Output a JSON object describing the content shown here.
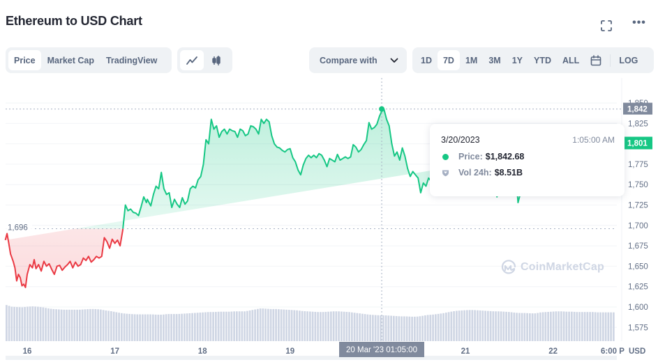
{
  "header": {
    "title": "Ethereum to USD Chart",
    "fullscreen_icon": "fullscreen-icon",
    "more_icon": "more-horizontal-icon",
    "more_label": "•••"
  },
  "toolbar": {
    "view_tabs": [
      {
        "label": "Price",
        "active": true
      },
      {
        "label": "Market Cap",
        "active": false
      },
      {
        "label": "TradingView",
        "active": false
      }
    ],
    "chart_types": [
      {
        "icon": "line-chart-icon",
        "active": true
      },
      {
        "icon": "candlestick-icon",
        "active": false
      }
    ],
    "compare_label": "Compare with",
    "ranges": [
      {
        "label": "1D",
        "active": false
      },
      {
        "label": "7D",
        "active": true
      },
      {
        "label": "1M",
        "active": false
      },
      {
        "label": "3M",
        "active": false
      },
      {
        "label": "1Y",
        "active": false
      },
      {
        "label": "YTD",
        "active": false
      },
      {
        "label": "ALL",
        "active": false
      }
    ],
    "calendar_icon": "calendar-icon",
    "log_label": "LOG"
  },
  "tooltip": {
    "date": "3/20/2023",
    "time": "1:05:00 AM",
    "price_label": "Price:",
    "price_value": "$1,842.68",
    "vol_label": "Vol 24h:",
    "vol_value": "$8.51B"
  },
  "watermark": "CoinMarketCap",
  "colors": {
    "up": "#16c784",
    "down": "#ea3943",
    "volume": "#cfd6e4",
    "crosshair_badge": "#808a9d",
    "current_badge": "#16c784"
  },
  "chart_data": {
    "type": "area",
    "title": "Ethereum to USD Chart",
    "xlabel": "",
    "ylabel": "USD",
    "currency_label": "USD",
    "x_unit": "days since Mar 15 2023 00:00 (local)",
    "x_range": [
      15.75,
      22.72
    ],
    "ylim": [
      1565,
      1868
    ],
    "y_ticks": [
      1575,
      1600,
      1625,
      1650,
      1675,
      1700,
      1725,
      1750,
      1775,
      1800,
      1825,
      1850
    ],
    "y_tick_labels": [
      "1,575",
      "1,600",
      "1,625",
      "1,650",
      "1,675",
      "1,700",
      "1,725",
      "1,750",
      "1,775",
      "1,800",
      "1,825",
      "1,850"
    ],
    "x_ticks": [
      16,
      17,
      18,
      19,
      20,
      21,
      22
    ],
    "x_tick_labels": [
      "16",
      "17",
      "18",
      "19",
      "",
      "21",
      "22"
    ],
    "x_end_label": "6:00 P",
    "baseline": {
      "value": 1696,
      "label": "1,696"
    },
    "crosshair": {
      "x": 20.045,
      "value": 1842.68,
      "x_label": "20 Mar '23   01:05:00",
      "y_label": "1,842"
    },
    "current_price": {
      "value": 1801,
      "label": "1,801"
    },
    "grid": true,
    "series": [
      {
        "name": "Price",
        "x": [
          15.75,
          15.77,
          15.79,
          15.81,
          15.84,
          15.86,
          15.88,
          15.9,
          15.92,
          15.94,
          15.96,
          15.98,
          16.0,
          16.03,
          16.06,
          16.08,
          16.1,
          16.13,
          16.16,
          16.19,
          16.22,
          16.25,
          16.28,
          16.31,
          16.34,
          16.37,
          16.4,
          16.43,
          16.46,
          16.49,
          16.52,
          16.55,
          16.58,
          16.61,
          16.64,
          16.67,
          16.7,
          16.73,
          16.76,
          16.79,
          16.82,
          16.85,
          16.88,
          16.91,
          16.94,
          16.97,
          17.0,
          17.03,
          17.06,
          17.09,
          17.12,
          17.15,
          17.18,
          17.21,
          17.24,
          17.27,
          17.3,
          17.33,
          17.36,
          17.37,
          17.39,
          17.41,
          17.44,
          17.47,
          17.5,
          17.53,
          17.56,
          17.59,
          17.62,
          17.65,
          17.68,
          17.71,
          17.74,
          17.77,
          17.8,
          17.83,
          17.86,
          17.89,
          17.92,
          17.95,
          17.98,
          18.01,
          18.04,
          18.07,
          18.1,
          18.13,
          18.16,
          18.19,
          18.22,
          18.25,
          18.28,
          18.31,
          18.34,
          18.37,
          18.4,
          18.43,
          18.46,
          18.49,
          18.52,
          18.55,
          18.58,
          18.61,
          18.64,
          18.67,
          18.7,
          18.73,
          18.76,
          18.79,
          18.82,
          18.85,
          18.88,
          18.91,
          18.94,
          18.97,
          19.0,
          19.03,
          19.06,
          19.09,
          19.12,
          19.15,
          19.18,
          19.21,
          19.24,
          19.27,
          19.3,
          19.33,
          19.36,
          19.39,
          19.42,
          19.45,
          19.48,
          19.51,
          19.54,
          19.57,
          19.6,
          19.63,
          19.66,
          19.69,
          19.72,
          19.75,
          19.78,
          19.81,
          19.84,
          19.87,
          19.9,
          19.93,
          19.96,
          19.99,
          20.02,
          20.045,
          20.07,
          20.1,
          20.13,
          20.16,
          20.19,
          20.22,
          20.25,
          20.28,
          20.31,
          20.34,
          20.37,
          20.4,
          20.43,
          20.46,
          20.49,
          20.52,
          20.55,
          20.58,
          20.61,
          20.64,
          20.67,
          20.7,
          20.73,
          20.76,
          20.79,
          20.82,
          20.85,
          20.88,
          20.91,
          20.94,
          20.97,
          21.0,
          21.03,
          21.06,
          21.09,
          21.12,
          21.15,
          21.18,
          21.21,
          21.24,
          21.27,
          21.3,
          21.33,
          21.36,
          21.39,
          21.42,
          21.45,
          21.48,
          21.51,
          21.54,
          21.57,
          21.6,
          21.63,
          21.66,
          21.69,
          21.72,
          21.75,
          21.78,
          21.81,
          21.84,
          21.87,
          21.9,
          21.93,
          21.96,
          21.99,
          22.02,
          22.05,
          22.08,
          22.11,
          22.14,
          22.17,
          22.2,
          22.23,
          22.26,
          22.29,
          22.32,
          22.35,
          22.38,
          22.41,
          22.44,
          22.47,
          22.5,
          22.53,
          22.56,
          22.59,
          22.62,
          22.65,
          22.68,
          22.72
        ],
        "values": [
          1682,
          1690,
          1678,
          1665,
          1656,
          1648,
          1632,
          1640,
          1636,
          1626,
          1628,
          1624,
          1640,
          1652,
          1648,
          1658,
          1647,
          1652,
          1644,
          1656,
          1650,
          1653,
          1646,
          1640,
          1650,
          1651,
          1645,
          1649,
          1652,
          1656,
          1648,
          1655,
          1650,
          1652,
          1660,
          1657,
          1662,
          1655,
          1658,
          1662,
          1660,
          1662,
          1685,
          1680,
          1672,
          1683,
          1678,
          1682,
          1675,
          1694,
          1725,
          1718,
          1720,
          1716,
          1715,
          1712,
          1723,
          1735,
          1728,
          1732,
          1728,
          1724,
          1738,
          1748,
          1745,
          1765,
          1745,
          1738,
          1740,
          1722,
          1732,
          1726,
          1722,
          1734,
          1726,
          1730,
          1745,
          1748,
          1746,
          1756,
          1760,
          1775,
          1805,
          1800,
          1830,
          1818,
          1822,
          1808,
          1815,
          1818,
          1812,
          1818,
          1816,
          1815,
          1808,
          1818,
          1816,
          1810,
          1812,
          1822,
          1821,
          1818,
          1812,
          1830,
          1825,
          1830,
          1827,
          1810,
          1800,
          1796,
          1795,
          1792,
          1790,
          1793,
          1794,
          1783,
          1778,
          1768,
          1762,
          1774,
          1782,
          1786,
          1783,
          1786,
          1783,
          1788,
          1786,
          1780,
          1772,
          1782,
          1780,
          1778,
          1787,
          1780,
          1782,
          1784,
          1782,
          1784,
          1799,
          1796,
          1790,
          1793,
          1799,
          1804,
          1826,
          1818,
          1820,
          1824,
          1834,
          1840,
          1842.68,
          1830,
          1822,
          1800,
          1785,
          1790,
          1780,
          1795,
          1785,
          1770,
          1760,
          1766,
          1762,
          1758,
          1740,
          1752,
          1748,
          1758,
          1754,
          1756,
          1765,
          1785,
          1780,
          1778,
          1748,
          1755,
          1740,
          1760,
          1752,
          1760,
          1775,
          1790,
          1786,
          1780,
          1772,
          1780,
          1770,
          1776,
          1768,
          1760,
          1766,
          1775,
          1750,
          1735,
          1745,
          1760,
          1770,
          1780,
          1778,
          1765,
          1772,
          1728,
          1740,
          1745,
          1762,
          1772,
          1775,
          1782,
          1790,
          1798,
          1795,
          1802,
          1798,
          1800,
          1795,
          1799,
          1801,
          1804,
          1800,
          1802,
          1806,
          1800,
          1798,
          1802,
          1805,
          1799,
          1801,
          1800,
          1802,
          1804,
          1801,
          1799,
          1801
        ]
      },
      {
        "name": "Volume 24h (relative, axis hidden)",
        "values_relative": [
          1.0,
          0.95,
          0.94,
          0.93,
          0.95,
          0.96,
          0.95,
          0.93,
          0.9,
          0.88,
          0.87,
          0.86,
          0.86,
          0.86,
          0.86,
          0.87,
          0.88,
          0.88,
          0.87,
          0.84,
          0.82,
          0.79,
          0.76,
          0.74,
          0.73,
          0.72,
          0.72,
          0.72,
          0.72,
          0.71,
          0.71,
          0.73,
          0.73,
          0.73,
          0.74,
          0.75,
          0.76,
          0.77,
          0.78,
          0.79,
          0.79,
          0.8,
          0.8,
          0.8,
          0.81,
          0.81,
          0.81,
          0.84,
          0.87,
          0.9,
          0.89,
          0.88,
          0.88,
          0.87,
          0.86,
          0.85,
          0.84,
          0.82,
          0.81,
          0.8,
          0.79,
          0.79,
          0.8,
          0.81,
          0.81,
          0.8,
          0.79,
          0.77,
          0.75,
          0.73,
          0.71,
          0.7,
          0.69,
          0.69,
          0.68,
          0.67,
          0.66,
          0.66,
          0.65,
          0.65,
          0.67,
          0.7,
          0.71,
          0.73,
          0.75,
          0.78,
          0.81,
          0.83,
          0.84,
          0.85,
          0.85,
          0.84,
          0.83,
          0.82,
          0.81,
          0.81,
          0.8,
          0.79,
          0.77,
          0.76,
          0.76,
          0.75,
          0.75,
          0.78,
          0.79,
          0.8,
          0.81,
          0.81,
          0.8,
          0.8,
          0.79,
          0.79,
          0.79,
          0.79,
          0.78,
          0.78,
          0.78,
          0.78
        ]
      }
    ]
  }
}
